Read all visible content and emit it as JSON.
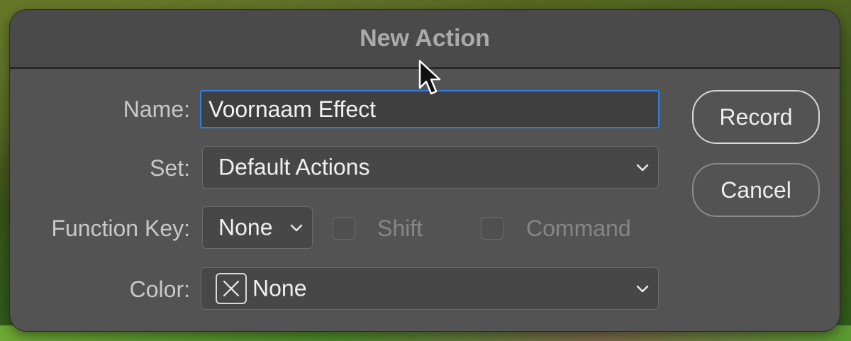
{
  "dialog": {
    "title": "New Action",
    "name": {
      "label": "Name:",
      "value": "Voornaam Effect"
    },
    "set": {
      "label": "Set:",
      "value": "Default Actions"
    },
    "function_key": {
      "label": "Function Key:",
      "value": "None"
    },
    "shift": {
      "label": "Shift",
      "checked": false
    },
    "command": {
      "label": "Command",
      "checked": false
    },
    "color": {
      "label": "Color:",
      "value": "None"
    },
    "buttons": {
      "record": "Record",
      "cancel": "Cancel"
    }
  },
  "icons": [
    "chevron-down-icon",
    "color-none-swatch-icon",
    "mouse-pointer-icon"
  ],
  "colors": {
    "dialog_bg": "#535353",
    "focus_ring": "#2f7fe0"
  }
}
